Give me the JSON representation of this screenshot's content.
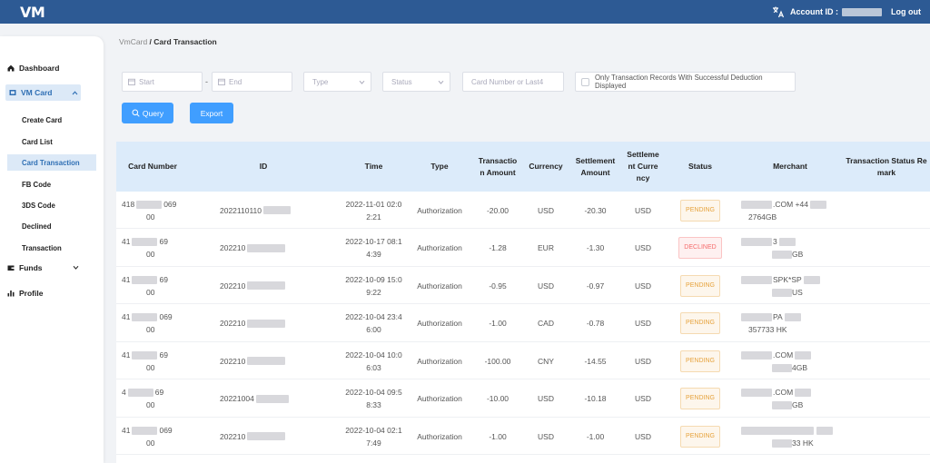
{
  "app": {
    "logo": "VM",
    "account_label": "Account ID :",
    "logout": "Log out"
  },
  "sidebar": {
    "dashboard": "Dashboard",
    "vm_card": "VM Card",
    "sub_items": [
      "Create Card",
      "Card List",
      "Card Transaction",
      "FB Code",
      "3DS Code",
      "Declined",
      "Transaction"
    ],
    "funds": "Funds",
    "profile": "Profile"
  },
  "breadcrumb": {
    "parent": "VmCard",
    "sep": " / ",
    "current": "Card Transaction"
  },
  "filters": {
    "start": "Start",
    "dash": "-",
    "end": "End",
    "type": "Type",
    "status": "Status",
    "card_number": "Card Number or Last4",
    "only_success": "Only Transaction Records With Successful Deduction Displayed"
  },
  "buttons": {
    "query": "Query",
    "export": "Export"
  },
  "table": {
    "headers": {
      "card_number": "Card Number",
      "id": "ID",
      "time": "Time",
      "type": "Type",
      "txn_amount": "Transactio n Amount",
      "currency": "Currency",
      "settle_amount": "Settlement Amount",
      "settle_currency": "Settleme nt Curre ncy",
      "status": "Status",
      "merchant": "Merchant",
      "remark": "Transaction Status Re mark"
    },
    "rows": [
      {
        "card_a": "418",
        "card_b": "069",
        "card_c": "00",
        "id": "2022110110",
        "time_a": "2022-11-01 02:0",
        "time_b": "2:21",
        "type": "Authorization",
        "amount": "-20.00",
        "currency": "USD",
        "settle": "-20.30",
        "settle_cur": "USD",
        "status": "PENDING",
        "merchant_a": ".COM +44",
        "merchant_b": "2764GB"
      },
      {
        "card_a": "41",
        "card_b": "69",
        "card_c": "00",
        "id": "202210",
        "time_a": "2022-10-17 08:1",
        "time_b": "4:39",
        "type": "Authorization",
        "amount": "-1.28",
        "currency": "EUR",
        "settle": "-1.30",
        "settle_cur": "USD",
        "status": "DECLINED",
        "merchant_a": "3",
        "merchant_b": "GB"
      },
      {
        "card_a": "41",
        "card_b": "69",
        "card_c": "00",
        "id": "202210",
        "time_a": "2022-10-09 15:0",
        "time_b": "9:22",
        "type": "Authorization",
        "amount": "-0.95",
        "currency": "USD",
        "settle": "-0.97",
        "settle_cur": "USD",
        "status": "PENDING",
        "merchant_a": "SPK*SP",
        "merchant_b": "US"
      },
      {
        "card_a": "41",
        "card_b": "069",
        "card_c": "00",
        "id": "202210",
        "time_a": "2022-10-04 23:4",
        "time_b": "6:00",
        "type": "Authorization",
        "amount": "-1.00",
        "currency": "CAD",
        "settle": "-0.78",
        "settle_cur": "USD",
        "status": "PENDING",
        "merchant_a": "PA",
        "merchant_b": "357733 HK"
      },
      {
        "card_a": "41",
        "card_b": "69",
        "card_c": "00",
        "id": "202210",
        "time_a": "2022-10-04 10:0",
        "time_b": "6:03",
        "type": "Authorization",
        "amount": "-100.00",
        "currency": "CNY",
        "settle": "-14.55",
        "settle_cur": "USD",
        "status": "PENDING",
        "merchant_a": ".COM",
        "merchant_b": "4GB"
      },
      {
        "card_a": "4",
        "card_b": "69",
        "card_c": "00",
        "id": "20221004",
        "time_a": "2022-10-04 09:5",
        "time_b": "8:33",
        "type": "Authorization",
        "amount": "-10.00",
        "currency": "USD",
        "settle": "-10.18",
        "settle_cur": "USD",
        "status": "PENDING",
        "merchant_a": ".COM",
        "merchant_b": "GB"
      },
      {
        "card_a": "41",
        "card_b": "069",
        "card_c": "00",
        "id": "202210",
        "time_a": "2022-10-04 02:1",
        "time_b": "7:49",
        "type": "Authorization",
        "amount": "-1.00",
        "currency": "USD",
        "settle": "-1.00",
        "settle_cur": "USD",
        "status": "PENDING",
        "merchant_a": "",
        "merchant_b": "33 HK"
      }
    ]
  },
  "colors": {
    "topbar": "#2d5a94",
    "primary_button": "#409eff",
    "active_nav": "#2f6fb4",
    "table_header": "#dcebfa",
    "pending": "#e6a23c",
    "declined": "#f56c6c"
  },
  "icons": {
    "translate": "translate-icon",
    "dashboard": "home-icon",
    "vm_card": "card-icon",
    "funds": "wallet-icon",
    "profile": "bar-chart-icon",
    "calendar": "calendar-icon",
    "dropdown": "chevron-down-icon",
    "query": "search-icon"
  }
}
